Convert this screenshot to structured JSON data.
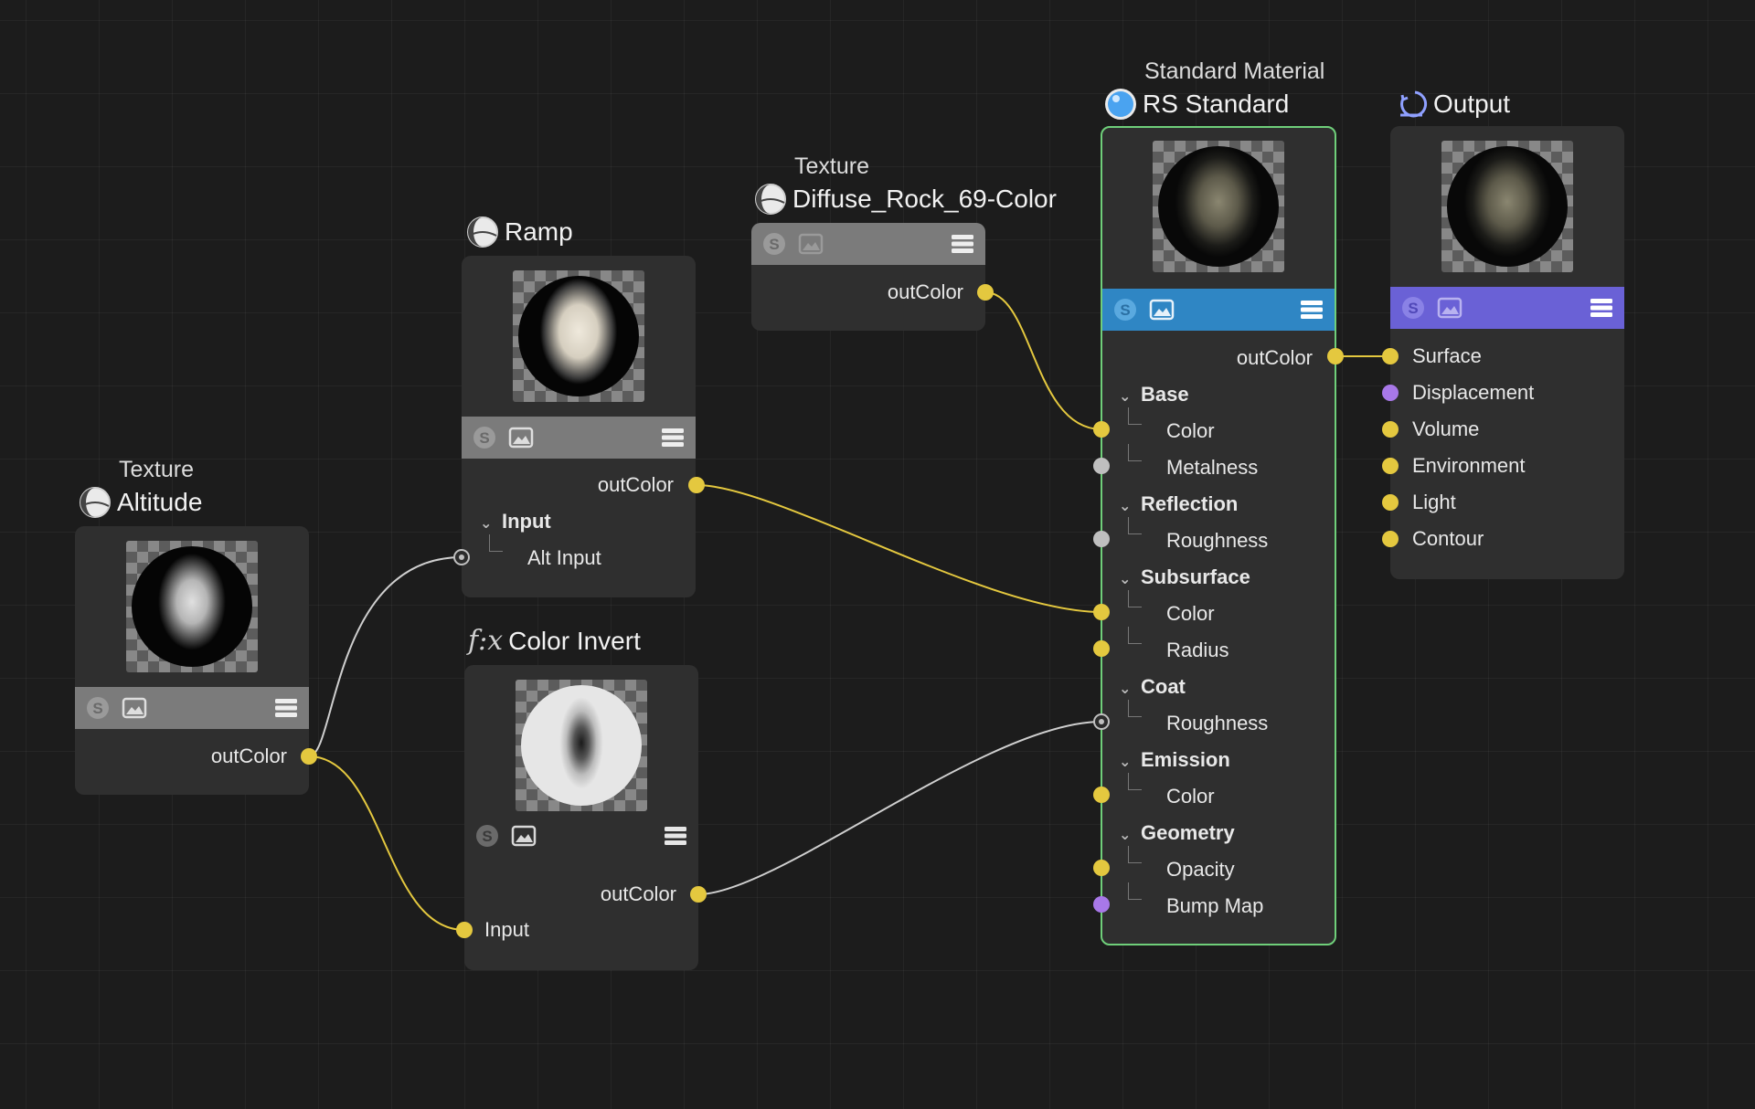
{
  "colors": {
    "wire_yellow": "#e4c83f",
    "wire_white": "#cfcfcf",
    "port_gray": "#bfbfbf",
    "port_purple": "#a878e8",
    "rs_toolbar": "#2f86c4",
    "output_toolbar": "#6a61d6",
    "selected_border": "#6fcf7a",
    "default_toolbar": "#7b7b7b"
  },
  "nodes": {
    "altitude": {
      "subtitle": "Texture",
      "title": "Altitude",
      "icon": "texture-globe-icon",
      "output": "outColor"
    },
    "ramp": {
      "title": "Ramp",
      "icon": "texture-globe-icon",
      "output": "outColor",
      "group": "Input",
      "inputs": [
        "Alt Input"
      ]
    },
    "color_invert": {
      "title_prefix": "f:x",
      "title": "Color Invert",
      "icon": "function-icon",
      "output": "outColor",
      "inputs": [
        "Input"
      ]
    },
    "diffuse": {
      "subtitle": "Texture",
      "title": "Diffuse_Rock_69-Color",
      "icon": "texture-globe-icon",
      "output": "outColor"
    },
    "rs_standard": {
      "subtitle": "Standard Material",
      "title": "RS Standard",
      "icon": "material-sphere-icon",
      "output": "outColor",
      "groups": [
        {
          "name": "Base",
          "inputs": [
            "Color",
            "Metalness"
          ]
        },
        {
          "name": "Reflection",
          "inputs": [
            "Roughness"
          ]
        },
        {
          "name": "Subsurface",
          "inputs": [
            "Color",
            "Radius"
          ]
        },
        {
          "name": "Coat",
          "inputs": [
            "Roughness"
          ]
        },
        {
          "name": "Emission",
          "inputs": [
            "Color"
          ]
        },
        {
          "name": "Geometry",
          "inputs": [
            "Opacity",
            "Bump Map"
          ]
        }
      ]
    },
    "output": {
      "title": "Output",
      "icon": "output-icon",
      "inputs": [
        "Surface",
        "Displacement",
        "Volume",
        "Environment",
        "Light",
        "Contour"
      ]
    }
  }
}
